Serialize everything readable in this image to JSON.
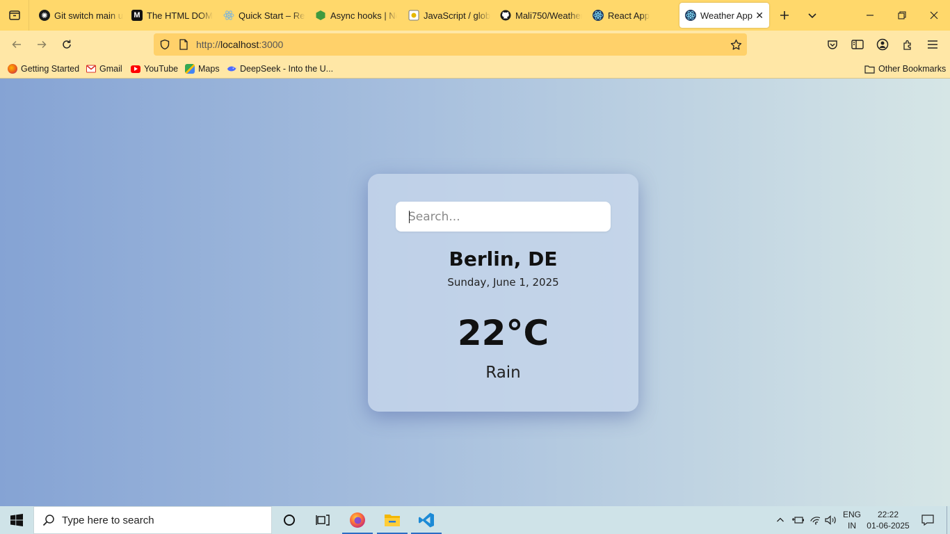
{
  "browser": {
    "tabs": [
      {
        "title": "Git switch main u",
        "icon": "openai-icon",
        "color": "#1b1b1b"
      },
      {
        "title": "The HTML DOM",
        "icon": "medium-icon",
        "color": "#111111"
      },
      {
        "title": "Quick Start – Rea",
        "icon": "react-icon",
        "color": "#7fb5d8"
      },
      {
        "title": "Async hooks | No",
        "icon": "nodejs-icon",
        "color": "#3f9a3f"
      },
      {
        "title": "JavaScript / glob",
        "icon": "mdn-icon",
        "color": "#6a6a6a"
      },
      {
        "title": "Mali750/Weather",
        "icon": "github-icon",
        "color": "#1b1b1b"
      },
      {
        "title": "React App",
        "icon": "react-icon",
        "color": "#1f3a5f"
      },
      {
        "title": "Weather App",
        "icon": "react-icon",
        "color": "#1f3a5f",
        "active": true
      }
    ],
    "url_prefix": "http://",
    "url_host": "localhost",
    "url_suffix": ":3000",
    "bookmarks": [
      {
        "label": "Getting Started",
        "icon": "firefox-icon",
        "color": "#e8561f"
      },
      {
        "label": "Gmail",
        "icon": "gmail-icon",
        "color": "#d93025"
      },
      {
        "label": "YouTube",
        "icon": "youtube-icon",
        "color": "#ff0000"
      },
      {
        "label": "Maps",
        "icon": "maps-icon",
        "color": "#34a853"
      },
      {
        "label": "DeepSeek - Into the U...",
        "icon": "deepseek-icon",
        "color": "#4d6bfe"
      }
    ],
    "other_bookmarks": "Other Bookmarks"
  },
  "app": {
    "search_placeholder": "Search...",
    "search_value": "",
    "city": "Berlin, DE",
    "date": "Sunday, June 1, 2025",
    "temperature": "22°C",
    "condition": "Rain"
  },
  "taskbar": {
    "search_placeholder": "Type here to search",
    "lang_top": "ENG",
    "lang_bottom": "IN",
    "time": "22:22",
    "date": "01-06-2025"
  },
  "colors": {
    "accent_tabbar": "#ffd86b",
    "accent_toolbar": "#ffe7a6",
    "bg_gradient_left": "#85a3d4",
    "bg_gradient_right": "#d6e6e6"
  }
}
